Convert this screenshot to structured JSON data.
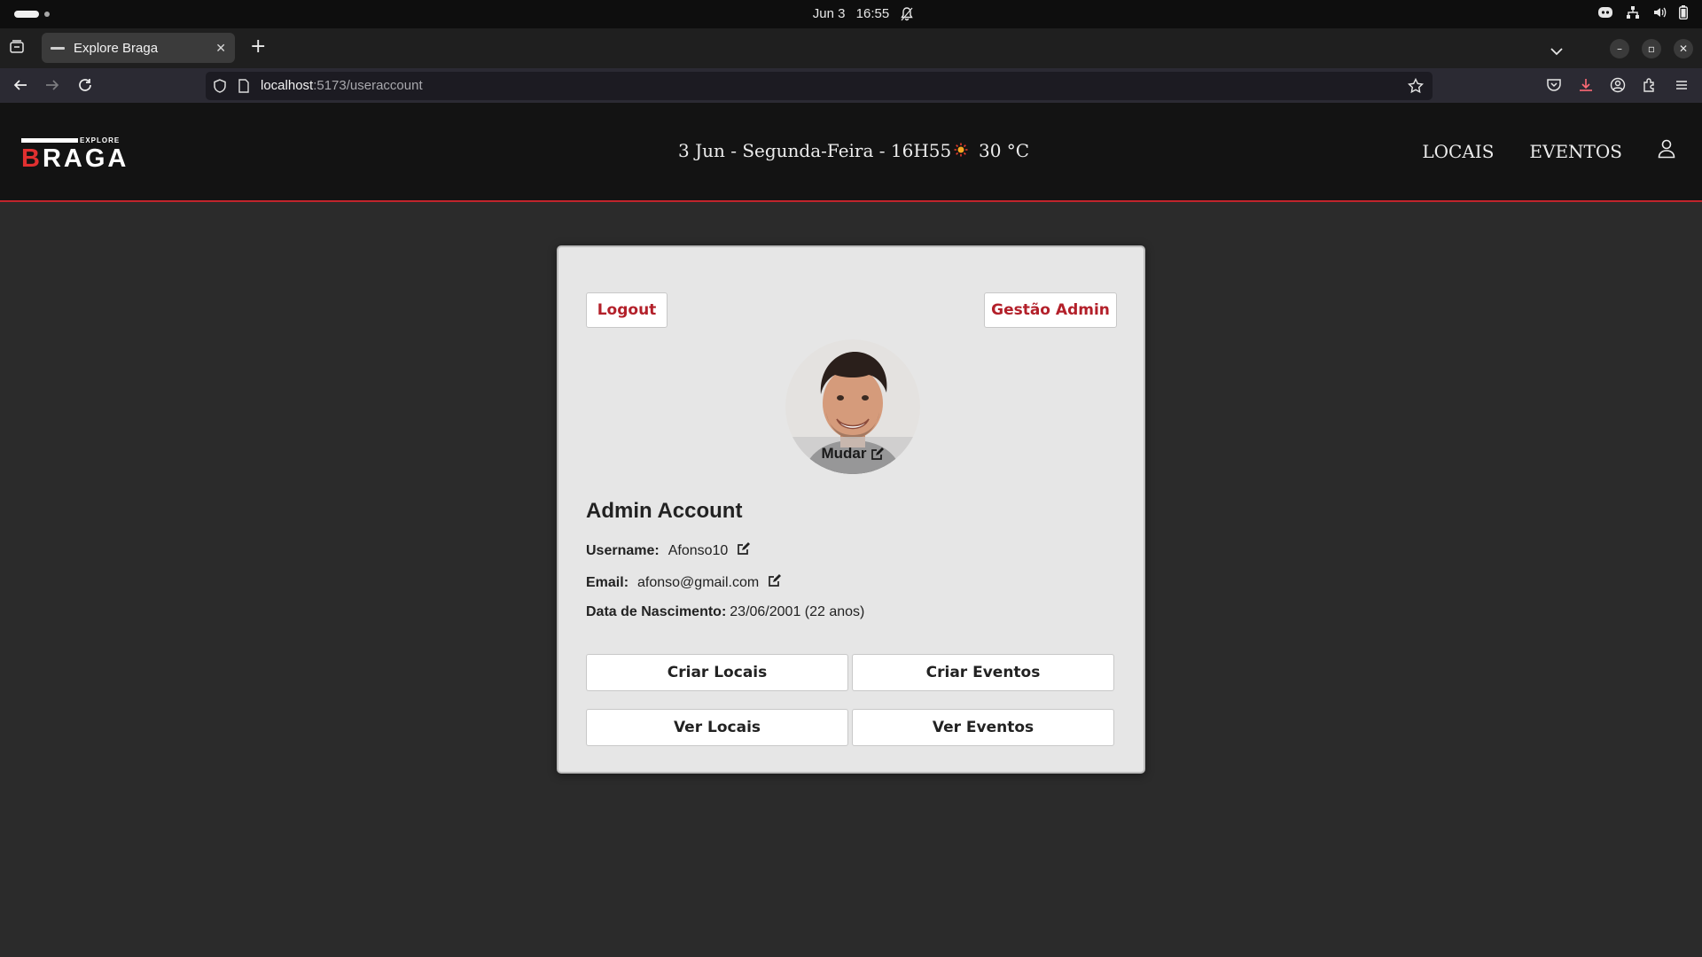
{
  "os": {
    "date": "Jun 3",
    "time": "16:55"
  },
  "browser": {
    "tab_title": "Explore Braga",
    "url_host": "localhost",
    "url_path": ":5173/useraccount"
  },
  "header": {
    "logo_small": "EXPLORE",
    "logo_first": "B",
    "logo_rest": "RAGA",
    "date_text": "3 Jun - Segunda-Feira - 16H55",
    "temperature": "30 °C",
    "nav": [
      "LOCAIS",
      "EVENTOS"
    ],
    "accent_color": "#c0242c"
  },
  "account": {
    "logout_label": "Logout",
    "admin_label": "Gestão Admin",
    "change_photo_label": "Mudar",
    "title": "Admin Account",
    "username_label": "Username:",
    "username": "Afonso10",
    "email_label": "Email:",
    "email": "afonso@gmail.com",
    "birth_label": "Data de Nascimento:",
    "birth_value": "23/06/2001 (22 anos)",
    "actions": [
      "Criar Locais",
      "Criar Eventos",
      "Ver Locais",
      "Ver Eventos"
    ]
  },
  "icons": {
    "tray": [
      "discord-icon",
      "network-icon",
      "volume-icon",
      "battery-icon"
    ],
    "edit": "edit-icon",
    "user": "user-icon",
    "weather": "sun-icon"
  }
}
